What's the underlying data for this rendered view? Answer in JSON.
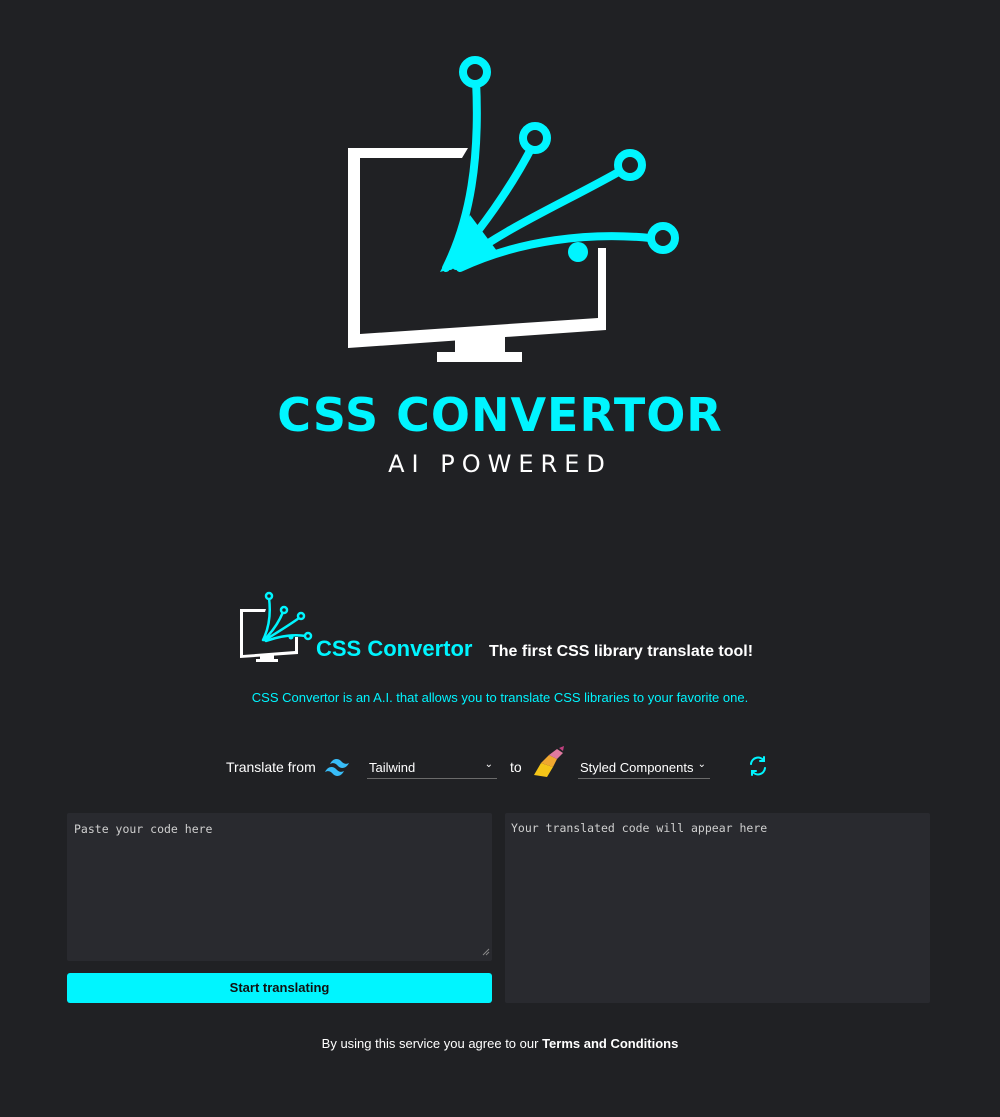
{
  "hero": {
    "title": "CSS CONVERTOR",
    "subtitle": "AI POWERED"
  },
  "brand": {
    "name": "CSS Convertor",
    "tagline": "The first CSS library translate tool!",
    "description": "CSS Convertor is an A.I. that allows you to translate CSS libraries to your favorite one."
  },
  "controls": {
    "from_label": "Translate from",
    "from_value": "Tailwind",
    "to_label": "to",
    "to_value": "Styled Components",
    "from_icon": "tailwind-icon",
    "to_icon": "styled-components-icon",
    "swap_icon": "swap-refresh-icon"
  },
  "editor": {
    "input_placeholder": "Paste your code here",
    "output_placeholder": "Your translated code will appear here",
    "translate_button": "Start translating"
  },
  "footer": {
    "text": "By using this service you agree to our",
    "terms_link": "Terms and Conditions"
  },
  "colors": {
    "background": "#202124",
    "accent": "#00f5ff",
    "panel": "#292a2f"
  }
}
